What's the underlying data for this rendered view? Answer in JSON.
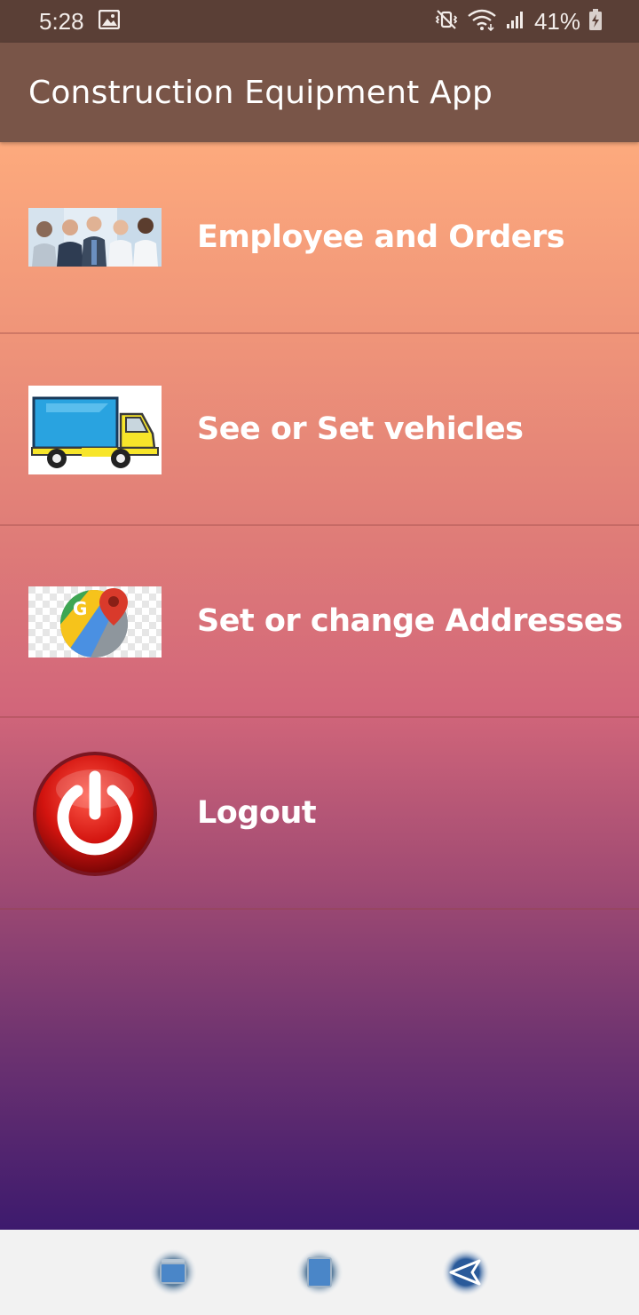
{
  "status_bar": {
    "time": "5:28",
    "battery": "41%",
    "icons": [
      "image-icon",
      "mute-vibrate-icon",
      "wifi-icon",
      "signal-icon",
      "battery-charging-icon"
    ]
  },
  "app_bar": {
    "title": "Construction Equipment App",
    "color": "#795548"
  },
  "menu": {
    "items": [
      {
        "label": "Employee and Orders",
        "icon": "employees-photo"
      },
      {
        "label": "See or Set vehicles",
        "icon": "truck-icon"
      },
      {
        "label": "Set or change Addresses",
        "icon": "google-maps-icon"
      },
      {
        "label": "Logout",
        "icon": "power-icon"
      }
    ]
  },
  "nav_bar": {
    "icons": [
      "recent-apps-icon",
      "home-icon",
      "back-icon"
    ]
  },
  "colors": {
    "status_bar": "#5a3f36",
    "gradient_top": "#fdaa7d",
    "gradient_bottom": "#3d1a6e"
  }
}
